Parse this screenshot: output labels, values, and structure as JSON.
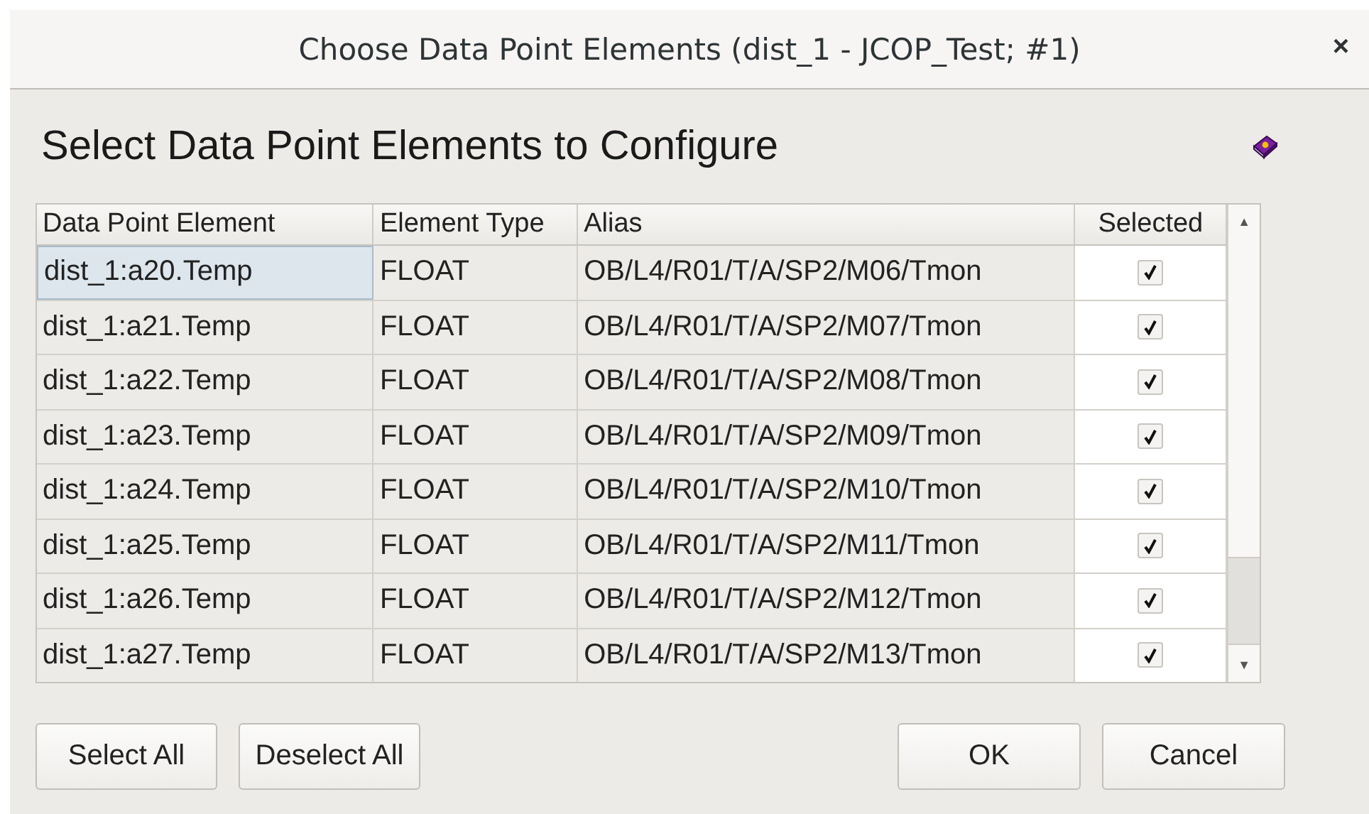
{
  "window": {
    "title": "Choose Data Point Elements (dist_1 - JCOP_Test; #1)",
    "close": "×"
  },
  "heading": "Select Data Point Elements to Configure",
  "table": {
    "columns": [
      "Data Point Element",
      "Element Type",
      "Alias",
      "Selected"
    ],
    "rows": [
      {
        "element": "dist_1:a20.Temp",
        "type": "FLOAT",
        "alias": "OB/L4/R01/T/A/SP2/M06/Tmon",
        "checked": true,
        "focused": true
      },
      {
        "element": "dist_1:a21.Temp",
        "type": "FLOAT",
        "alias": "OB/L4/R01/T/A/SP2/M07/Tmon",
        "checked": true,
        "focused": false
      },
      {
        "element": "dist_1:a22.Temp",
        "type": "FLOAT",
        "alias": "OB/L4/R01/T/A/SP2/M08/Tmon",
        "checked": true,
        "focused": false
      },
      {
        "element": "dist_1:a23.Temp",
        "type": "FLOAT",
        "alias": "OB/L4/R01/T/A/SP2/M09/Tmon",
        "checked": true,
        "focused": false
      },
      {
        "element": "dist_1:a24.Temp",
        "type": "FLOAT",
        "alias": "OB/L4/R01/T/A/SP2/M10/Tmon",
        "checked": true,
        "focused": false
      },
      {
        "element": "dist_1:a25.Temp",
        "type": "FLOAT",
        "alias": "OB/L4/R01/T/A/SP2/M11/Tmon",
        "checked": true,
        "focused": false
      },
      {
        "element": "dist_1:a26.Temp",
        "type": "FLOAT",
        "alias": "OB/L4/R01/T/A/SP2/M12/Tmon",
        "checked": true,
        "focused": false
      },
      {
        "element": "dist_1:a27.Temp",
        "type": "FLOAT",
        "alias": "OB/L4/R01/T/A/SP2/M13/Tmon",
        "checked": true,
        "focused": false
      }
    ]
  },
  "left_buttons": [
    "Select All",
    "Deselect All"
  ],
  "right_buttons": [
    "OK",
    "Cancel"
  ],
  "scrollbar": {
    "up": "▲",
    "down": "▼"
  }
}
